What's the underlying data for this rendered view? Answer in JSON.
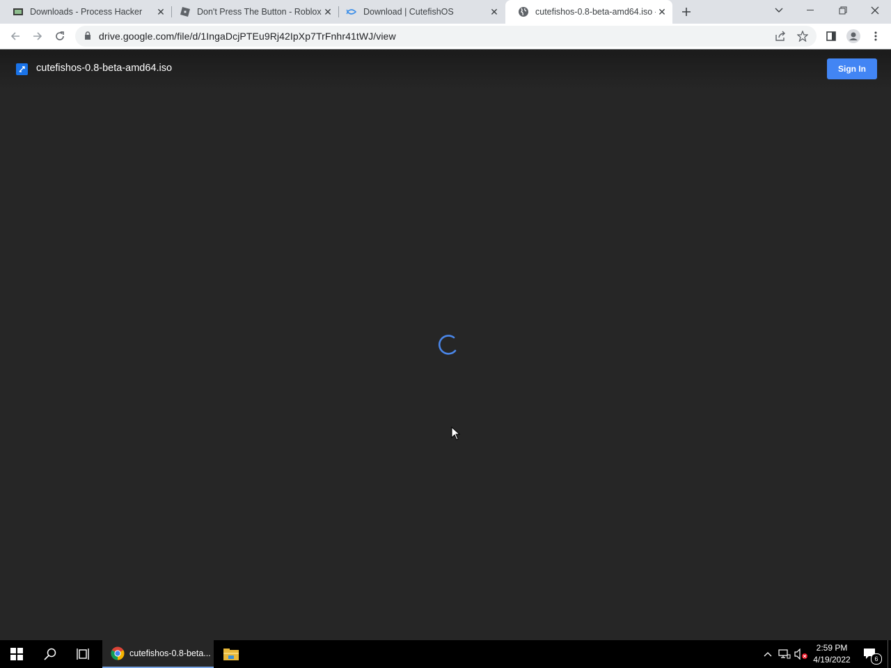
{
  "browser": {
    "tabs": [
      {
        "title": "Downloads - Process Hacker",
        "icon": "process-hacker-icon",
        "active": false
      },
      {
        "title": "Don't Press The Button - Roblox",
        "icon": "roblox-icon",
        "active": false
      },
      {
        "title": "Download | CutefishOS",
        "icon": "cutefish-icon",
        "active": false
      },
      {
        "title": "cutefishos-0.8-beta-amd64.iso -",
        "icon": "globe-icon",
        "active": true
      }
    ],
    "url": "drive.google.com/file/d/1IngaDcjPTEu9Rj42IpXp7TrFnhr41tWJ/view"
  },
  "viewer": {
    "file_name": "cutefishos-0.8-beta-amd64.iso",
    "sign_in_label": "Sign In",
    "loading": true
  },
  "taskbar": {
    "chrome_label": "cutefishos-0.8-beta...",
    "time": "2:59 PM",
    "date": "4/19/2022",
    "notification_count": "6"
  },
  "colors": {
    "viewer_bg": "#262626",
    "accent": "#4285f4",
    "spinner": "#4a86e8"
  }
}
